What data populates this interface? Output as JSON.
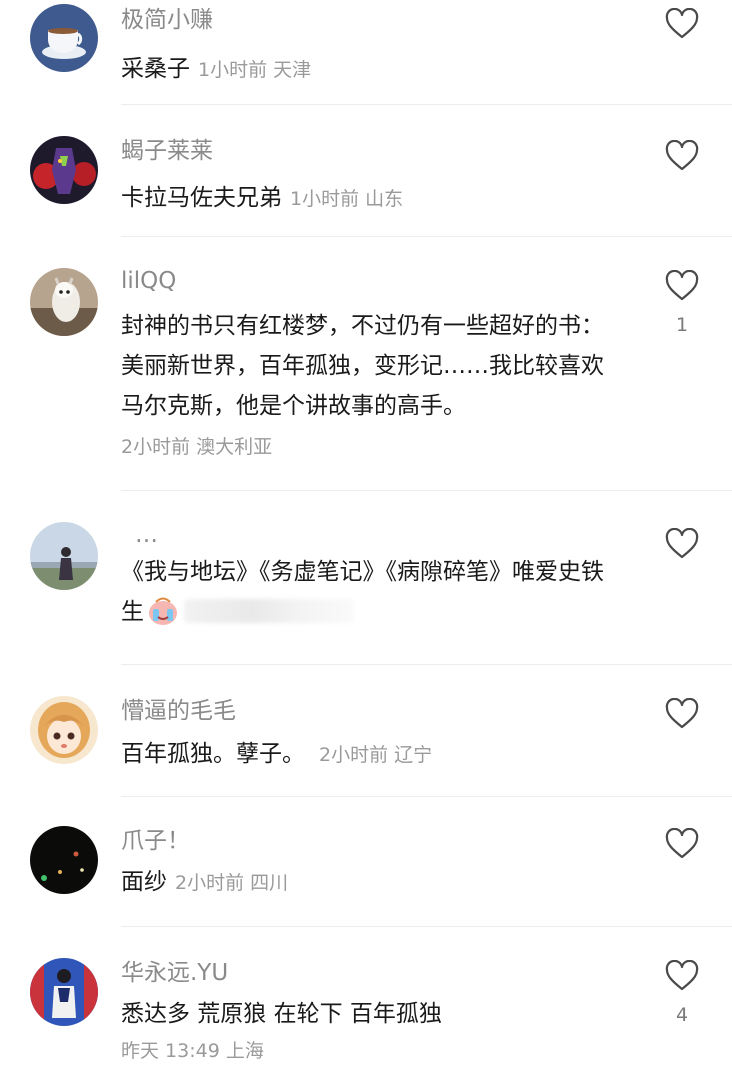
{
  "comments": [
    {
      "username": "极简小赚",
      "text": "采桑子",
      "time": "1小时前",
      "location": "天津",
      "likes": "",
      "avatar_icon": "coffee-cup-avatar"
    },
    {
      "username": "蝎子莱莱",
      "text": "卡拉马佐夫兄弟",
      "time": "1小时前",
      "location": "山东",
      "likes": "",
      "avatar_icon": "mecha-avatar"
    },
    {
      "username": "lilQQ",
      "text": "封神的书只有红楼梦，不过仍有一些超好的书：美丽新世界，百年孤独，变形记……我比较喜欢马尔克斯，他是个讲故事的高手。",
      "time": "2小时前",
      "location": "澳大利亚",
      "likes": "1",
      "avatar_icon": "alpaca-avatar"
    },
    {
      "username": "…",
      "text": "《我与地坛》《务虚笔记》《病隙碎笔》唯爱史铁生",
      "time": "",
      "location": "",
      "likes": "",
      "avatar_icon": "person-outdoor-avatar"
    },
    {
      "username": "懵逼的毛毛",
      "text": "百年孤独。孽子。",
      "time": "2小时前",
      "location": "辽宁",
      "likes": "",
      "avatar_icon": "anime-girl-avatar"
    },
    {
      "username": "爪子！",
      "text": "面纱",
      "time": "2小时前",
      "location": "四川",
      "likes": "",
      "avatar_icon": "night-lights-avatar"
    },
    {
      "username": "华永远.YU",
      "text": "悉达多 荒原狼 在轮下 百年孤独",
      "time": "昨天 13:49",
      "location": "上海",
      "likes": "4",
      "avatar_icon": "performer-avatar"
    }
  ],
  "colors": {
    "username": "#8a8a8a",
    "meta": "#9a9a9a",
    "text": "#1a1a1a",
    "divider": "#ececec"
  },
  "icons": {
    "like": "heart-outline-icon",
    "crying_emoji": "crying-emoji-icon"
  }
}
